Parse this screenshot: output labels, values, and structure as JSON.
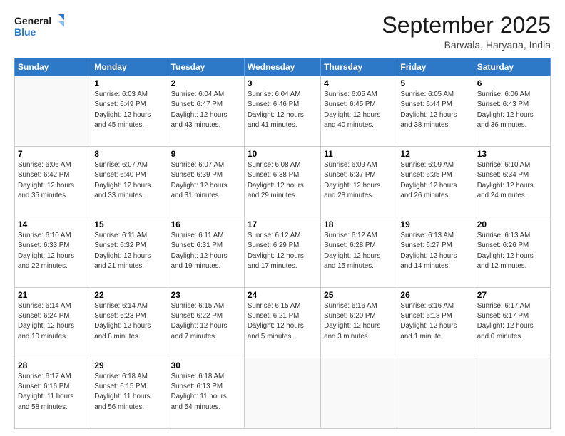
{
  "header": {
    "logo_line1": "General",
    "logo_line2": "Blue",
    "month": "September 2025",
    "location": "Barwala, Haryana, India"
  },
  "days_of_week": [
    "Sunday",
    "Monday",
    "Tuesday",
    "Wednesday",
    "Thursday",
    "Friday",
    "Saturday"
  ],
  "weeks": [
    [
      {
        "day": "",
        "info": ""
      },
      {
        "day": "1",
        "info": "Sunrise: 6:03 AM\nSunset: 6:49 PM\nDaylight: 12 hours\nand 45 minutes."
      },
      {
        "day": "2",
        "info": "Sunrise: 6:04 AM\nSunset: 6:47 PM\nDaylight: 12 hours\nand 43 minutes."
      },
      {
        "day": "3",
        "info": "Sunrise: 6:04 AM\nSunset: 6:46 PM\nDaylight: 12 hours\nand 41 minutes."
      },
      {
        "day": "4",
        "info": "Sunrise: 6:05 AM\nSunset: 6:45 PM\nDaylight: 12 hours\nand 40 minutes."
      },
      {
        "day": "5",
        "info": "Sunrise: 6:05 AM\nSunset: 6:44 PM\nDaylight: 12 hours\nand 38 minutes."
      },
      {
        "day": "6",
        "info": "Sunrise: 6:06 AM\nSunset: 6:43 PM\nDaylight: 12 hours\nand 36 minutes."
      }
    ],
    [
      {
        "day": "7",
        "info": "Sunrise: 6:06 AM\nSunset: 6:42 PM\nDaylight: 12 hours\nand 35 minutes."
      },
      {
        "day": "8",
        "info": "Sunrise: 6:07 AM\nSunset: 6:40 PM\nDaylight: 12 hours\nand 33 minutes."
      },
      {
        "day": "9",
        "info": "Sunrise: 6:07 AM\nSunset: 6:39 PM\nDaylight: 12 hours\nand 31 minutes."
      },
      {
        "day": "10",
        "info": "Sunrise: 6:08 AM\nSunset: 6:38 PM\nDaylight: 12 hours\nand 29 minutes."
      },
      {
        "day": "11",
        "info": "Sunrise: 6:09 AM\nSunset: 6:37 PM\nDaylight: 12 hours\nand 28 minutes."
      },
      {
        "day": "12",
        "info": "Sunrise: 6:09 AM\nSunset: 6:35 PM\nDaylight: 12 hours\nand 26 minutes."
      },
      {
        "day": "13",
        "info": "Sunrise: 6:10 AM\nSunset: 6:34 PM\nDaylight: 12 hours\nand 24 minutes."
      }
    ],
    [
      {
        "day": "14",
        "info": "Sunrise: 6:10 AM\nSunset: 6:33 PM\nDaylight: 12 hours\nand 22 minutes."
      },
      {
        "day": "15",
        "info": "Sunrise: 6:11 AM\nSunset: 6:32 PM\nDaylight: 12 hours\nand 21 minutes."
      },
      {
        "day": "16",
        "info": "Sunrise: 6:11 AM\nSunset: 6:31 PM\nDaylight: 12 hours\nand 19 minutes."
      },
      {
        "day": "17",
        "info": "Sunrise: 6:12 AM\nSunset: 6:29 PM\nDaylight: 12 hours\nand 17 minutes."
      },
      {
        "day": "18",
        "info": "Sunrise: 6:12 AM\nSunset: 6:28 PM\nDaylight: 12 hours\nand 15 minutes."
      },
      {
        "day": "19",
        "info": "Sunrise: 6:13 AM\nSunset: 6:27 PM\nDaylight: 12 hours\nand 14 minutes."
      },
      {
        "day": "20",
        "info": "Sunrise: 6:13 AM\nSunset: 6:26 PM\nDaylight: 12 hours\nand 12 minutes."
      }
    ],
    [
      {
        "day": "21",
        "info": "Sunrise: 6:14 AM\nSunset: 6:24 PM\nDaylight: 12 hours\nand 10 minutes."
      },
      {
        "day": "22",
        "info": "Sunrise: 6:14 AM\nSunset: 6:23 PM\nDaylight: 12 hours\nand 8 minutes."
      },
      {
        "day": "23",
        "info": "Sunrise: 6:15 AM\nSunset: 6:22 PM\nDaylight: 12 hours\nand 7 minutes."
      },
      {
        "day": "24",
        "info": "Sunrise: 6:15 AM\nSunset: 6:21 PM\nDaylight: 12 hours\nand 5 minutes."
      },
      {
        "day": "25",
        "info": "Sunrise: 6:16 AM\nSunset: 6:20 PM\nDaylight: 12 hours\nand 3 minutes."
      },
      {
        "day": "26",
        "info": "Sunrise: 6:16 AM\nSunset: 6:18 PM\nDaylight: 12 hours\nand 1 minute."
      },
      {
        "day": "27",
        "info": "Sunrise: 6:17 AM\nSunset: 6:17 PM\nDaylight: 12 hours\nand 0 minutes."
      }
    ],
    [
      {
        "day": "28",
        "info": "Sunrise: 6:17 AM\nSunset: 6:16 PM\nDaylight: 11 hours\nand 58 minutes."
      },
      {
        "day": "29",
        "info": "Sunrise: 6:18 AM\nSunset: 6:15 PM\nDaylight: 11 hours\nand 56 minutes."
      },
      {
        "day": "30",
        "info": "Sunrise: 6:18 AM\nSunset: 6:13 PM\nDaylight: 11 hours\nand 54 minutes."
      },
      {
        "day": "",
        "info": ""
      },
      {
        "day": "",
        "info": ""
      },
      {
        "day": "",
        "info": ""
      },
      {
        "day": "",
        "info": ""
      }
    ]
  ]
}
